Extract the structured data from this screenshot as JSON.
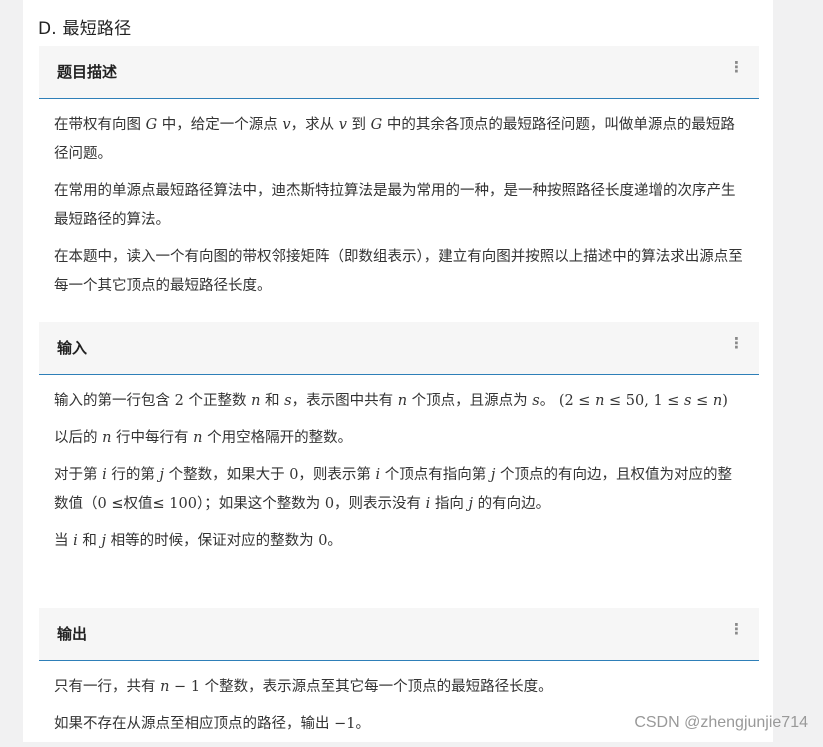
{
  "problem": {
    "title": "D. 最短路径"
  },
  "sections": {
    "description": {
      "header": "题目描述",
      "p1": {
        "a": "在带权有向图 ",
        "var_g1": "G",
        "b": " 中，给定一个源点 ",
        "var_v1": "v",
        "c": "，求从 ",
        "var_v2": "v",
        "d": " 到 ",
        "var_g2": "G",
        "e": " 中的其余各顶点的最短路径问题，叫做单源点的最短路径问题。"
      },
      "p2": "在常用的单源点最短路径算法中，迪杰斯特拉算法是最为常用的一种，是一种按照路径长度递增的次序产生最短路径的算法。",
      "p3": "在本题中，读入一个有向图的带权邻接矩阵（即数组表示），建立有向图并按照以上描述中的算法求出源点至每一个其它顶点的最短路径长度。"
    },
    "input": {
      "header": "输入",
      "p1": {
        "a": "输入的第一行包含 ",
        "num_2": "2",
        "b": " 个正整数 ",
        "var_n1": "n",
        "c": " 和 ",
        "var_s1": "s",
        "d": "，表示图中共有 ",
        "var_n2": "n",
        "e": " 个顶点，且源点为 ",
        "var_s2": "s",
        "f": "。",
        "range_open": "(2 ≤ ",
        "range_n1": "n",
        "range_mid": " ≤ 50, 1 ≤ ",
        "range_s": "s",
        "range_le": " ≤ ",
        "range_n2": "n",
        "range_close": ")"
      },
      "p2": {
        "a": "以后的 ",
        "var_n": "n",
        "b": " 行中每行有 ",
        "var_n2": "n",
        "c": " 个用空格隔开的整数。"
      },
      "p3": {
        "a": "对于第 ",
        "var_i1": "i",
        "b": " 行的第 ",
        "var_j1": "j",
        "c": " 个整数，如果大于 ",
        "num_0a": "0",
        "d": "，则表示第 ",
        "var_i2": "i",
        "e": " 个顶点有指向第 ",
        "var_j2": "j",
        "f": " 个顶点的有向边，且权值为对应的整数值（",
        "num_0b": "0",
        "g": " ≤权值≤ ",
        "num_100": "100",
        "h": "）；如果这个整数为 ",
        "num_0c": "0",
        "i": "，则表示没有 ",
        "var_i3": "i",
        "j": " 指向 ",
        "var_j3": "j",
        "k": " 的有向边。"
      },
      "p4": {
        "a": "当 ",
        "var_i": "i",
        "b": " 和 ",
        "var_j": "j",
        "c": " 相等的时候，保证对应的整数为 ",
        "num_0": "0",
        "d": "。"
      }
    },
    "output": {
      "header": "输出",
      "p1": {
        "a": "只有一行，共有 ",
        "expr_n": "n",
        "expr_rest": " − 1",
        "b": " 个整数，表示源点至其它每一个顶点的最短路径长度。"
      },
      "p2": {
        "a": "如果不存在从源点至相应顶点的路径，输出 ",
        "num_neg1": "−1",
        "b": "。"
      }
    }
  },
  "menu_icon": "more-vertical-icon",
  "menu_glyph": "⋮",
  "watermark": "CSDN @zhengjunjie714"
}
